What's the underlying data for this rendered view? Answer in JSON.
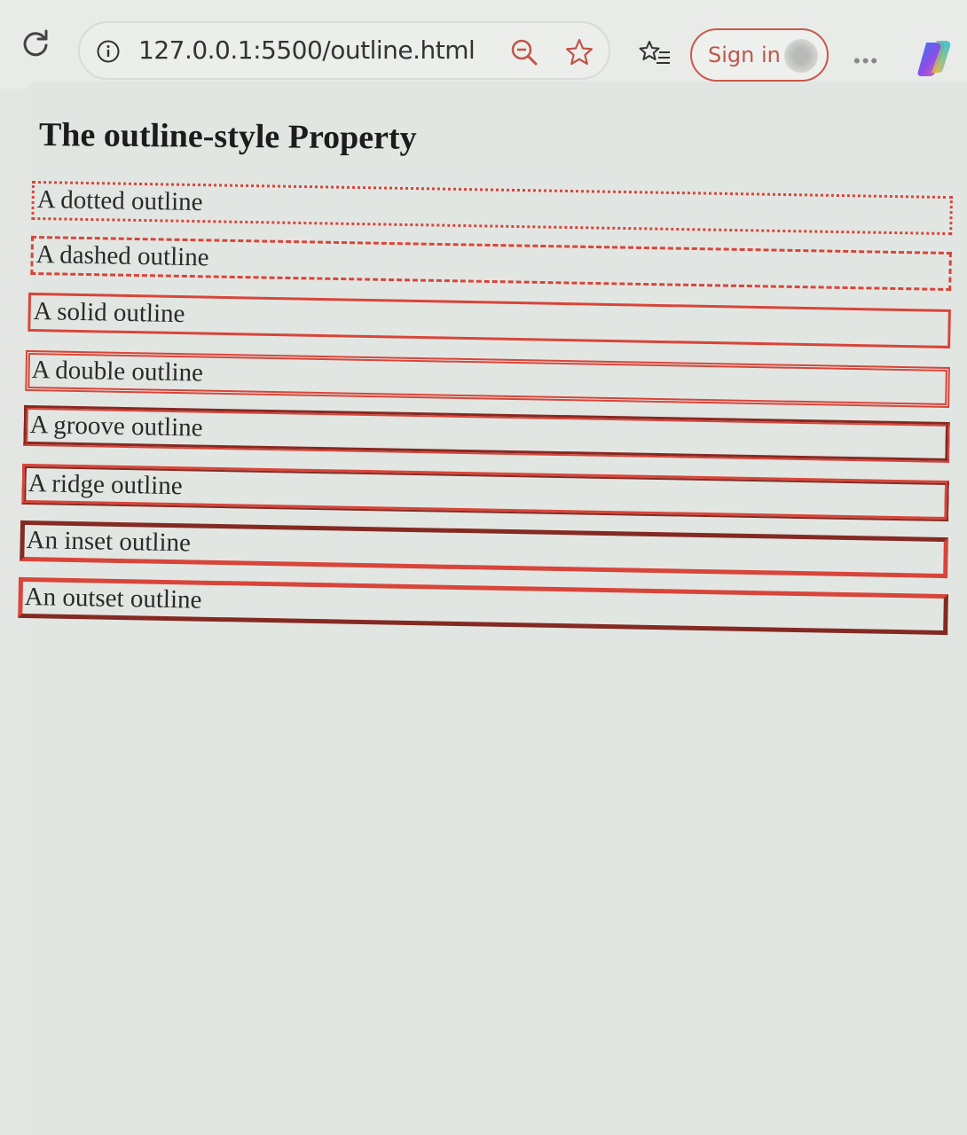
{
  "browser": {
    "url": "127.0.0.1:5500/outline.html",
    "signin_label": "Sign in",
    "more_label": "•••",
    "icons": [
      "reload-icon",
      "info-icon",
      "zoom-out-icon",
      "favorite-star-icon",
      "favorites-list-icon",
      "profile-avatar",
      "more-icon",
      "copilot-icon"
    ]
  },
  "page": {
    "title": "The outline-style Property",
    "outline_color": "#d8453a",
    "rows": [
      {
        "label": "A dotted outline",
        "style": "dotted"
      },
      {
        "label": "A dashed outline",
        "style": "dashed"
      },
      {
        "label": "A solid outline",
        "style": "solid"
      },
      {
        "label": "A double outline",
        "style": "double"
      },
      {
        "label": "A groove outline",
        "style": "groove"
      },
      {
        "label": "A ridge outline",
        "style": "ridge"
      },
      {
        "label": "An inset outline",
        "style": "inset"
      },
      {
        "label": "An outset outline",
        "style": "outset"
      }
    ]
  }
}
